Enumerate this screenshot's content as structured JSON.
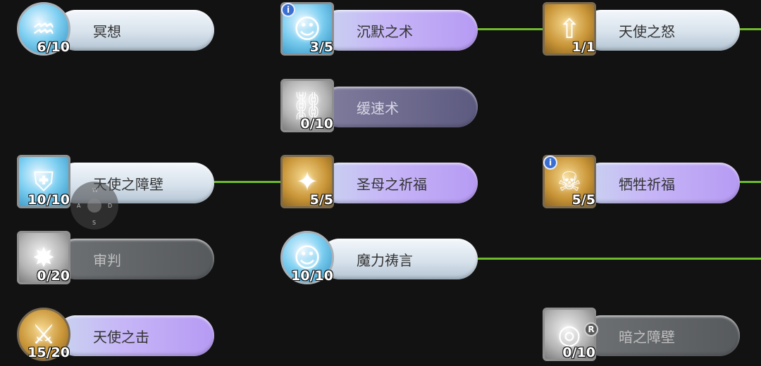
{
  "skills": {
    "meditation": {
      "name": "冥想",
      "level": "6/10"
    },
    "silence": {
      "name": "沉默之术",
      "level": "3/5",
      "badge": "i"
    },
    "angel_wrath": {
      "name": "天使之怒",
      "level": "1/1"
    },
    "slow": {
      "name": "缓速术",
      "level": "0/10"
    },
    "angel_barrier": {
      "name": "天使之障壁",
      "level": "10/10"
    },
    "holy_mother": {
      "name": "圣母之祈福",
      "level": "5/5"
    },
    "sacrifice": {
      "name": "牺牲祈福",
      "level": "5/5",
      "badge": "i"
    },
    "judgment": {
      "name": "审判",
      "level": "0/20"
    },
    "magic_prayer": {
      "name": "魔力祷言",
      "level": "10/10"
    },
    "angel_strike": {
      "name": "天使之击",
      "level": "15/20"
    },
    "dark_barrier": {
      "name": "暗之障壁",
      "level": "0/10",
      "badge": "R"
    }
  },
  "joystick": {
    "up": "W",
    "left": "A",
    "right": "D",
    "down": "S"
  },
  "colors": {
    "connector": "#6dbb2b",
    "background": "#121212"
  }
}
